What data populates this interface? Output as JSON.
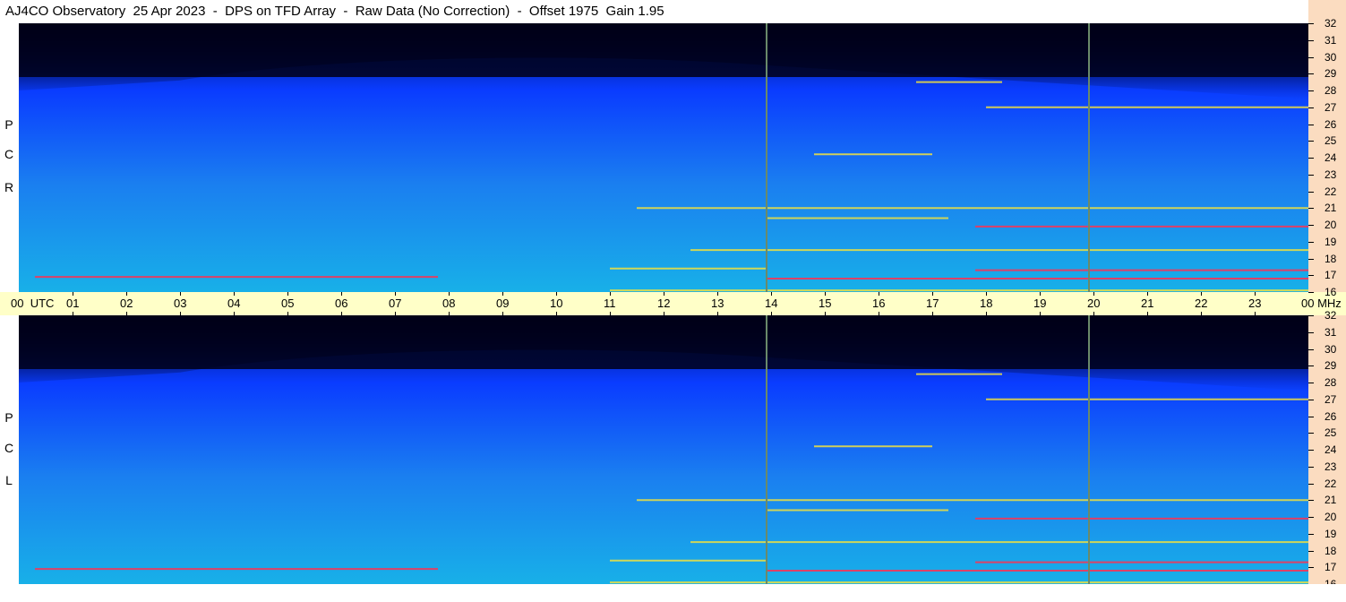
{
  "title": "AJ4CO Observatory  25 Apr 2023  -  DPS on TFD Array  -  Raw Data (No Correction)  -  Offset 1975  Gain 1.95",
  "panels": {
    "top": {
      "letters": [
        "R",
        "C",
        "P"
      ]
    },
    "bottom": {
      "letters": [
        "L",
        "C",
        "P"
      ]
    }
  },
  "time_axis": {
    "first_label": "00",
    "unit_label": "UTC",
    "labels": [
      "01",
      "02",
      "03",
      "04",
      "05",
      "06",
      "07",
      "08",
      "09",
      "10",
      "11",
      "12",
      "13",
      "14",
      "15",
      "16",
      "17",
      "18",
      "19",
      "20",
      "21",
      "22",
      "23"
    ],
    "last_label": "00",
    "last_unit": "MHz"
  },
  "freq_axis": {
    "labels": [
      "32",
      "31",
      "30",
      "29",
      "28",
      "27",
      "26",
      "25",
      "24",
      "23",
      "22",
      "21",
      "20",
      "19",
      "18",
      "17",
      "16"
    ]
  },
  "colors": {
    "background_dark": "#000018",
    "spectrum_blue": "#0a3cff",
    "spectrum_cyan": "#1ea0f0",
    "interference_yellow": "#f0e040",
    "interference_red": "#ff3050",
    "axis_time_bg": "#ffffc8",
    "axis_freq_bg": "#fbdcc0"
  },
  "chart_data": {
    "type": "heatmap",
    "title": "AJ4CO Observatory  25 Apr 2023  -  DPS on TFD Array  -  Raw Data (No Correction)  -  Offset 1975  Gain 1.95",
    "x_unit": "UTC",
    "y_unit": "MHz",
    "xlim": [
      0,
      24
    ],
    "ylim": [
      16,
      32
    ],
    "x_ticks": [
      "00",
      "01",
      "02",
      "03",
      "04",
      "05",
      "06",
      "07",
      "08",
      "09",
      "10",
      "11",
      "12",
      "13",
      "14",
      "15",
      "16",
      "17",
      "18",
      "19",
      "20",
      "21",
      "22",
      "23",
      "00"
    ],
    "y_ticks": [
      16,
      17,
      18,
      19,
      20,
      21,
      22,
      23,
      24,
      25,
      26,
      27,
      28,
      29,
      30,
      31,
      32
    ],
    "panels": [
      "RCP",
      "LCP"
    ],
    "vertical_markers_utc": [
      13.9,
      19.9
    ],
    "interference_lines_mhz": [
      {
        "freq": 16.9,
        "start": 0.3,
        "end": 7.8,
        "color": "#ff3050"
      },
      {
        "freq": 17.4,
        "start": 11.0,
        "end": 13.9,
        "color": "#f0e040"
      },
      {
        "freq": 17.3,
        "start": 17.8,
        "end": 24.0,
        "color": "#ff3050"
      },
      {
        "freq": 16.8,
        "start": 13.9,
        "end": 24.0,
        "color": "#ff3050"
      },
      {
        "freq": 19.9,
        "start": 17.8,
        "end": 24.0,
        "color": "#ff3050"
      },
      {
        "freq": 27.0,
        "start": 18.0,
        "end": 24.0,
        "color": "#f0e040"
      },
      {
        "freq": 28.5,
        "start": 16.7,
        "end": 18.3,
        "color": "#f0e040"
      },
      {
        "freq": 21.0,
        "start": 11.5,
        "end": 24.0,
        "color": "#f0e040"
      },
      {
        "freq": 24.2,
        "start": 14.8,
        "end": 17.0,
        "color": "#f0e040"
      },
      {
        "freq": 20.4,
        "start": 13.9,
        "end": 17.3,
        "color": "#f0e040"
      },
      {
        "freq": 18.5,
        "start": 12.5,
        "end": 24.0,
        "color": "#f0e040"
      },
      {
        "freq": 16.1,
        "start": 11.0,
        "end": 24.0,
        "color": "#f0e040"
      }
    ]
  }
}
